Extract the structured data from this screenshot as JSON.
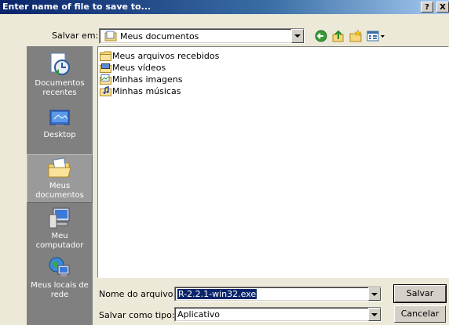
{
  "window": {
    "title": "Enter name of file to save to...",
    "help_label": "?",
    "close_label": "X"
  },
  "toolbar": {
    "save_in_label": "Salvar em:",
    "current_folder": "Meus documentos",
    "icons": [
      "back-icon",
      "up-folder-icon",
      "new-folder-icon",
      "view-menu-icon"
    ]
  },
  "places": [
    {
      "label": "Documentos recentes",
      "icon": "recent-documents-icon"
    },
    {
      "label": "Desktop",
      "icon": "desktop-icon"
    },
    {
      "label": "Meus documentos",
      "icon": "my-documents-icon"
    },
    {
      "label": "Meu computador",
      "icon": "my-computer-icon"
    },
    {
      "label": "Meus locais de rede",
      "icon": "network-places-icon"
    }
  ],
  "files": [
    {
      "name": "Meus arquivos recebidos",
      "icon": "folder-icon"
    },
    {
      "name": "Meus vídeos",
      "icon": "videos-folder-icon"
    },
    {
      "name": "Minhas imagens",
      "icon": "pictures-folder-icon"
    },
    {
      "name": "Minhas músicas",
      "icon": "music-folder-icon"
    }
  ],
  "form": {
    "filename_label": "Nome do arquivo:",
    "filename_value": "R-2.2.1-win32.exe",
    "filetype_label": "Salvar como tipo:",
    "filetype_value": "Aplicativo"
  },
  "buttons": {
    "save": "Salvar",
    "cancel": "Cancelar"
  },
  "colors": {
    "title_bar": "#0a246a",
    "places_bar": "#808080",
    "dialog_bg": "#ece9d8"
  }
}
